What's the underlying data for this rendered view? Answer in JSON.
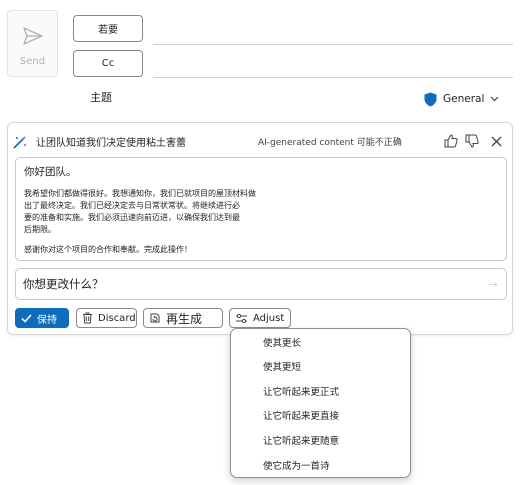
{
  "compose": {
    "send_label": "Send",
    "to_label": "若要",
    "cc_label": "Cc",
    "subject_label": "主题",
    "sensitivity_label": "General"
  },
  "copilot": {
    "prompt": "让团队知道我们决定使用粘土害蕾",
    "ai_warning": "AI-generated content 可能不正确",
    "draft": {
      "greeting": "你好团队。",
      "body": "我希望你们都做得很好。我想通知你，我们已就项目的屋顶材料做\n出了最终决定。我们已经决定去与日常状常状。将继续进行必\n要的准备和实施。我们必须迅速向前迈进，以确保我们达到最\n后期限。",
      "thanks": "感谢你对这个项目的合作和奉献。完成此操作！"
    },
    "followup_placeholder": "你想更改什么？",
    "buttons": {
      "keep": "保持",
      "discard": "Discard",
      "regenerate": "再生成",
      "adjust": "Adjust"
    },
    "adjust_menu": [
      "使其更长",
      "使其更短",
      "让它听起来更正式",
      "让它听起来更直接",
      "让它听起来更随意",
      "使它成为一首诗"
    ]
  },
  "colors": {
    "accent": "#0f6cbd",
    "shield": "#0f6cbd"
  },
  "icons": {
    "send": "paper-plane-icon",
    "copilot": "copilot-pen-icon",
    "thumbs_up": "thumbs-up-icon",
    "thumbs_down": "thumbs-down-icon",
    "close": "close-icon",
    "keep": "checkmark-icon",
    "discard": "trash-icon",
    "regenerate": "regenerate-icon",
    "adjust": "sliders-icon",
    "shield": "shield-icon"
  }
}
